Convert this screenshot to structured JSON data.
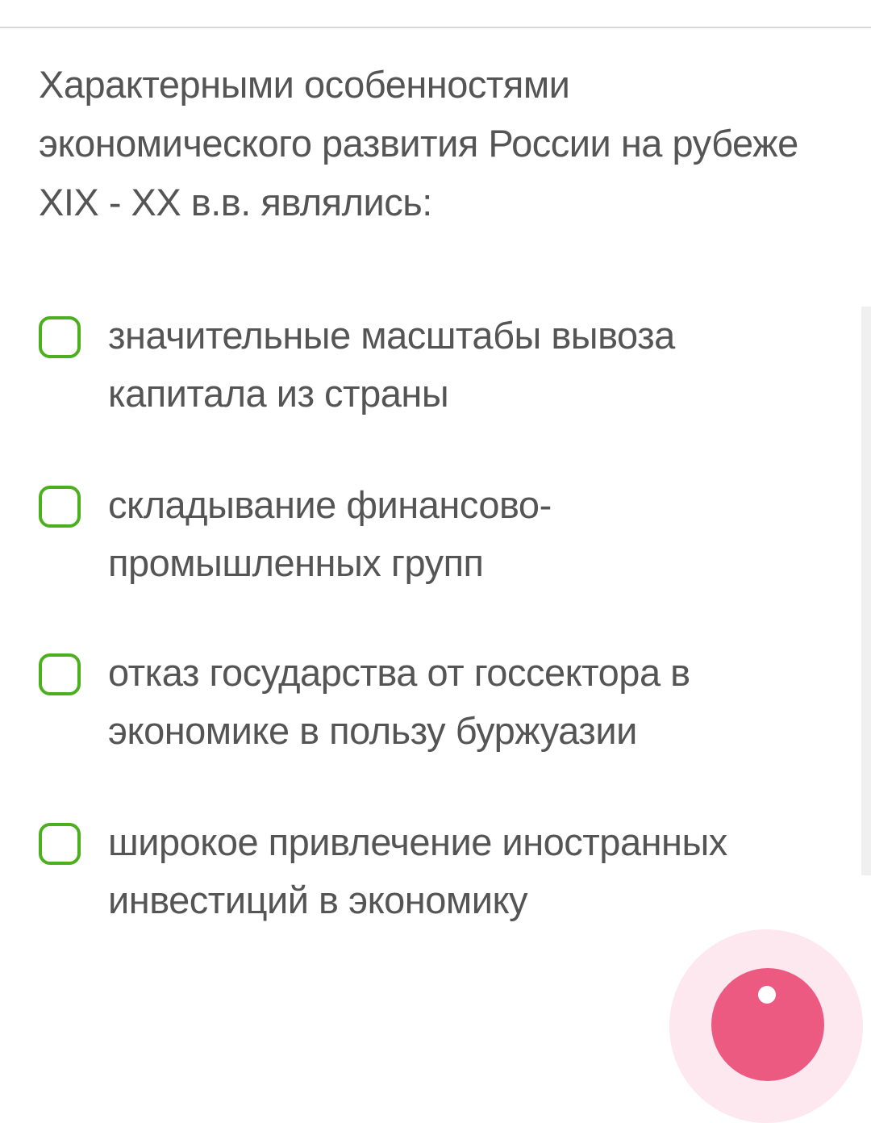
{
  "question": {
    "text": "Характерными особенностями экономического развития России на рубеже XIX - XX в.в. являлись:"
  },
  "options": [
    {
      "label": "значительные масштабы вывоза капитала из страны",
      "checked": false
    },
    {
      "label": "складывание финансово-промышленных групп",
      "checked": false
    },
    {
      "label": "отказ государства от госсектора в экономике в пользу буржуазии",
      "checked": false
    },
    {
      "label": "широкое привлечение иностранных инвестиций в экономику",
      "checked": false
    }
  ],
  "colors": {
    "checkbox_border": "#4caf1e",
    "text": "#555555",
    "fab": "#ec5a82",
    "fab_halo": "#fce8ee"
  },
  "fab": {
    "icon": "add-icon"
  }
}
